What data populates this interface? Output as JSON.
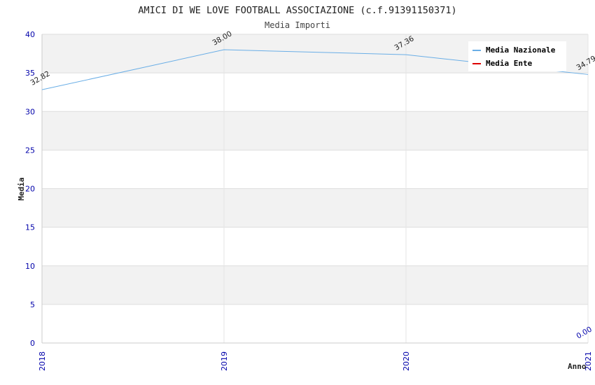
{
  "chart_data": {
    "type": "line",
    "title": "AMICI DI WE LOVE FOOTBALL ASSOCIAZIONE (c.f.91391150371)",
    "subtitle": "Media Importi",
    "xlabel": "Anno",
    "ylabel": "Media",
    "categories": [
      "2018",
      "2019",
      "2020",
      "2021"
    ],
    "ylim": [
      0,
      40
    ],
    "yticks": [
      0,
      5,
      10,
      15,
      20,
      25,
      30,
      35,
      40
    ],
    "series": [
      {
        "name": "Media Nazionale",
        "color": "#6aaee6",
        "values": [
          32.82,
          38.0,
          37.36,
          34.79
        ],
        "labels": [
          "32.82",
          "38.00",
          "37.36",
          "34.79"
        ]
      },
      {
        "name": "Media Ente",
        "color": "#dd0000",
        "values": [
          null,
          null,
          null,
          0
        ],
        "labels": [
          null,
          null,
          null,
          "0.00"
        ]
      }
    ],
    "legend_position": "top-right",
    "grid": true
  }
}
